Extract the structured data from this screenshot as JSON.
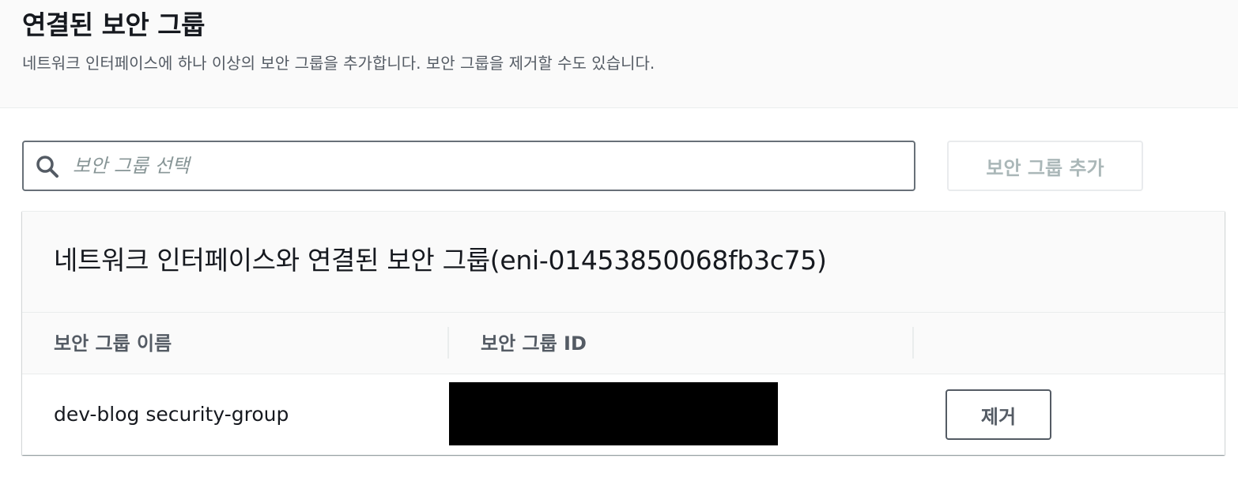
{
  "header": {
    "title": "연결된 보안 그룹",
    "description": "네트워크 인터페이스에 하나 이상의 보안 그룹을 추가합니다. 보안 그룹을 제거할 수도 있습니다."
  },
  "search": {
    "icon": "search-icon",
    "placeholder": "보안 그룹 선택",
    "value": ""
  },
  "add_button": {
    "label": "보안 그룹 추가",
    "disabled": true
  },
  "table": {
    "title": "네트워크 인터페이스와 연결된 보안 그룹(eni-01453850068fb3c75)",
    "columns": [
      "보안 그룹 이름",
      "보안 그룹 ID",
      ""
    ],
    "rows": [
      {
        "name": "dev-blog security-group",
        "id_redacted": true,
        "action_label": "제거"
      }
    ]
  },
  "colors": {
    "header_bg": "#fafafa",
    "text_primary": "#16191f",
    "text_secondary": "#545b64",
    "disabled_text": "#aab7b8",
    "border": "#eaeded"
  }
}
